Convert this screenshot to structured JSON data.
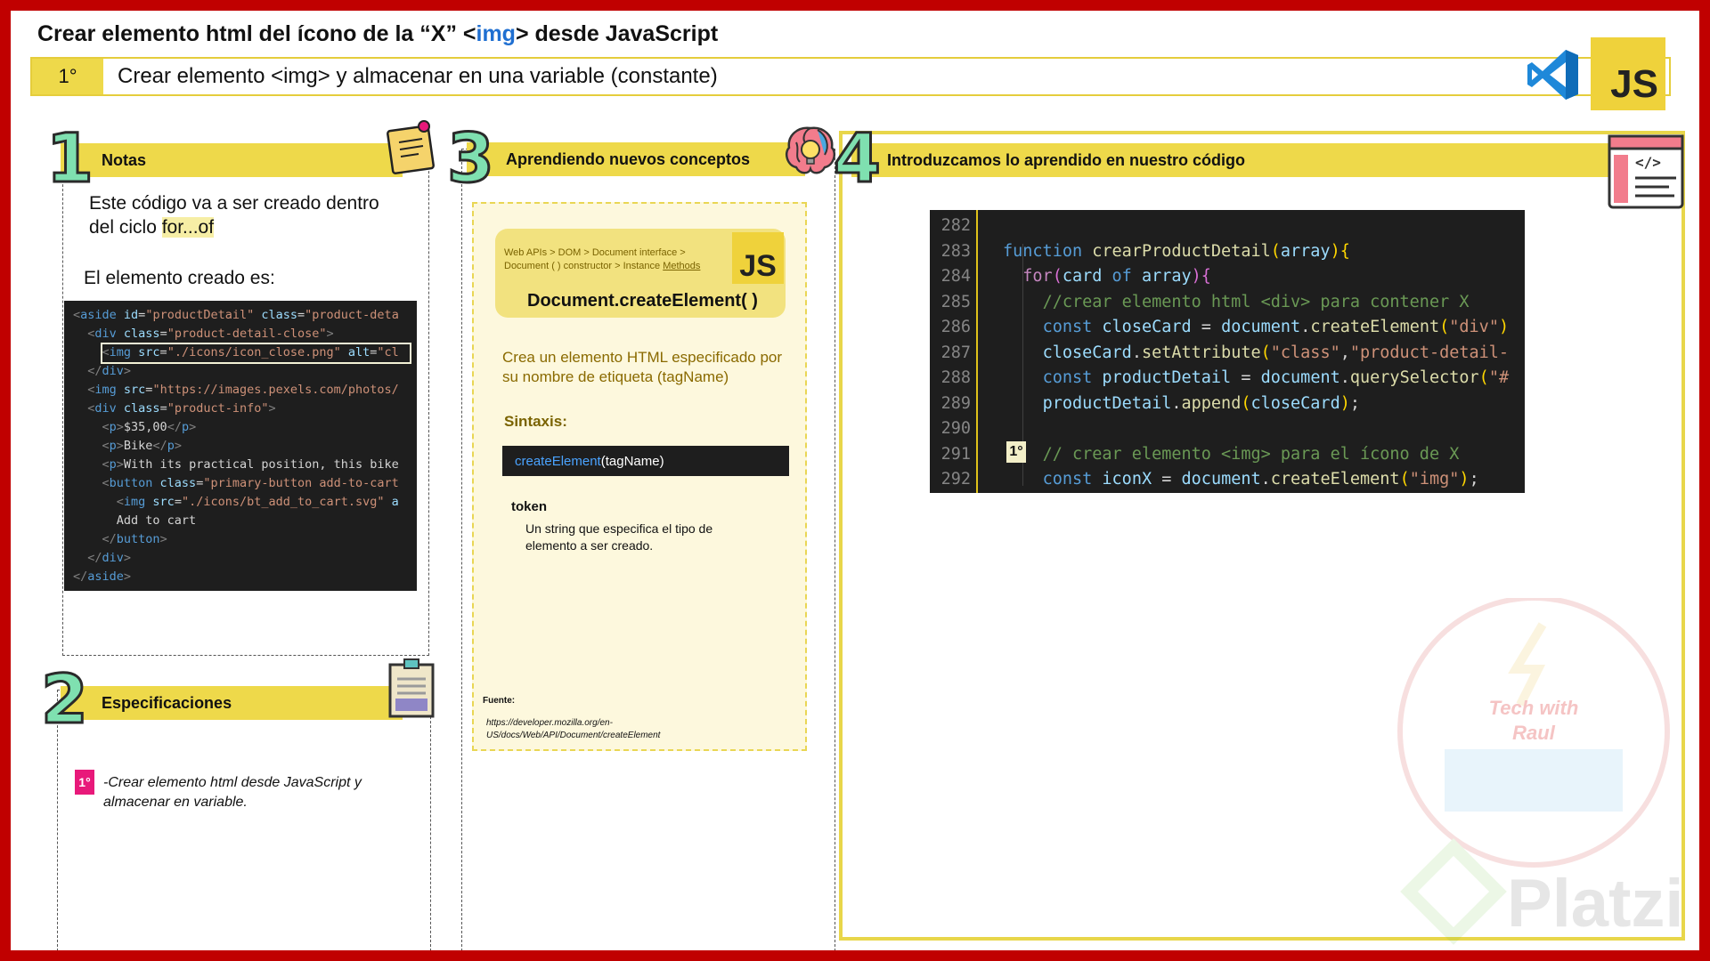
{
  "header": {
    "title_before": "Crear elemento html del ícono de la “X” <",
    "title_tag": "img",
    "title_after": "> desde JavaScript",
    "step_number": "1°",
    "step_text": "Crear elemento <img> y almacenar en una variable (constante)",
    "js_badge": "JS",
    "vscode_icon": "vscode-logo-icon"
  },
  "notes": {
    "number": "1",
    "title": "Notas",
    "line1": "Este código va a ser creado dentro",
    "line2_prefix": "del ciclo ",
    "line2_highlight": "for...of",
    "created_label": "El elemento creado es:",
    "code_lines": [
      [
        "<",
        "aside",
        " id",
        "=",
        "\"productDetail\"",
        " class",
        "=",
        "\"product-deta"
      ],
      [
        "  <",
        "div",
        " class",
        "=",
        "\"product-detail-close\"",
        ">"
      ],
      [
        "    <",
        "img",
        " src",
        "=",
        "\"./icons/icon_close.png\"",
        " alt",
        "=",
        "\"cl"
      ],
      [
        "  </",
        "div",
        ">"
      ],
      [
        "  <",
        "img",
        " src",
        "=",
        "\"https://images.pexels.com/photos/"
      ],
      [
        "  <",
        "div",
        " class",
        "=",
        "\"product-info\"",
        ">"
      ],
      [
        "    <",
        "p",
        ">",
        "$35,00",
        "</",
        "p",
        ">"
      ],
      [
        "    <",
        "p",
        ">",
        "Bike",
        "</",
        "p",
        ">"
      ],
      [
        "    <",
        "p",
        ">",
        "With its practical position, this bike"
      ],
      [
        "    <",
        "button",
        " class",
        "=",
        "\"primary-button add-to-cart"
      ],
      [
        "      <",
        "img",
        " src",
        "=",
        "\"./icons/bt_add_to_cart.svg\"",
        " a"
      ],
      [
        "      Add to cart"
      ],
      [
        "    </",
        "button",
        ">"
      ],
      [
        "  </",
        "div",
        ">"
      ],
      [
        "</",
        "aside",
        ">"
      ]
    ]
  },
  "specs": {
    "number": "2",
    "title": "Especificaciones",
    "badge": "1°",
    "text": "-Crear elemento html desde JavaScript y almacenar en variable."
  },
  "concepts": {
    "number": "3",
    "title": "Aprendiendo nuevos conceptos",
    "crumb_line1": "Web  APIs  >  DOM  >  Document  interface  >",
    "crumb_line2_prefix": "Document ( ) constructor > Instance ",
    "crumb_line2_link": "Methods",
    "js_badge": "JS",
    "method_title": "Document.createElement( )",
    "description": "Crea un elemento HTML especificado por su nombre de etiqueta (tagName)",
    "syntax_label": "Sintaxis:",
    "syntax_fn": "createElement",
    "syntax_args": "(tagName)",
    "token_label": "token",
    "token_desc": "Un string que especifica el tipo de elemento a ser creado.",
    "source_label": "Fuente:",
    "source_url": "https://developer.mozilla.org/en-US/docs/Web/API/Document/createElement"
  },
  "code_panel": {
    "number": "4",
    "title": "Introduzcamos lo aprendido en nuestro código",
    "line_numbers": [
      "282",
      "283",
      "284",
      "285",
      "286",
      "287",
      "288",
      "289",
      "290",
      "291",
      "292"
    ],
    "badge": "1°"
  },
  "watermark": {
    "brand": "Platzi",
    "logo_text_1": "Tech with",
    "logo_text_2": "Raul"
  },
  "colors": {
    "frame": "#c00000",
    "accent_yellow": "#eed94a",
    "pink_badge": "#e8197a",
    "link_blue": "#1f6fd1"
  }
}
